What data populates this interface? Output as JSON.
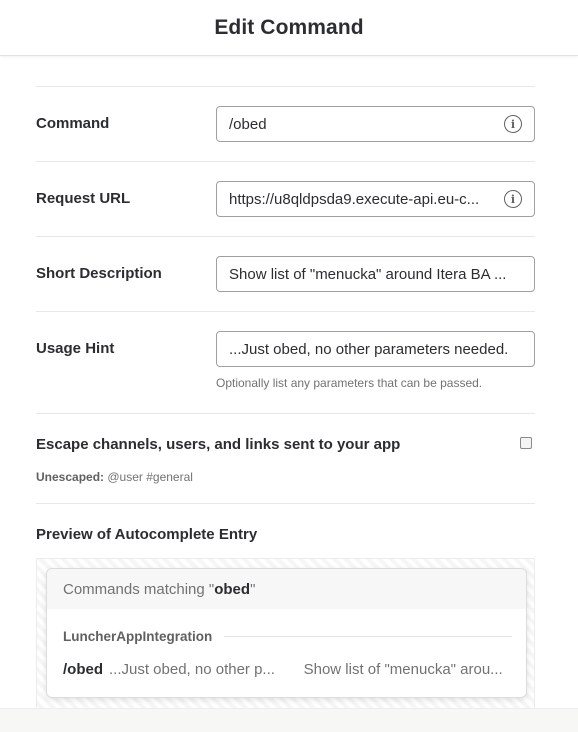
{
  "header": {
    "title": "Edit Command"
  },
  "form": {
    "command": {
      "label": "Command",
      "value": "/obed",
      "icon": "info-icon"
    },
    "request_url": {
      "label": "Request URL",
      "value": "https://u8qldpsda9.execute-api.eu-c...",
      "icon": "info-icon"
    },
    "short_description": {
      "label": "Short Description",
      "value": "Show list of \"menucka\" around Itera BA ..."
    },
    "usage_hint": {
      "label": "Usage Hint",
      "value": "...Just obed, no other parameters needed.",
      "hint": "Optionally list any parameters that can be passed."
    },
    "escape": {
      "label": "Escape channels, users, and links sent to your app",
      "checked": false,
      "unescaped_label": "Unescaped:",
      "unescaped_example": "@user #general"
    }
  },
  "preview": {
    "title": "Preview of Autocomplete Entry",
    "matching_prefix": "Commands matching \"",
    "matching_term": "obed",
    "matching_suffix": "\"",
    "app_name": "LuncherAppIntegration",
    "entry": {
      "command": "/obed",
      "usage": "...Just obed, no other p...",
      "description": "Show list of \"menucka\" arou..."
    }
  },
  "colors": {
    "text": "#2c2d30",
    "muted": "#717274",
    "border": "#a0a0a2"
  }
}
